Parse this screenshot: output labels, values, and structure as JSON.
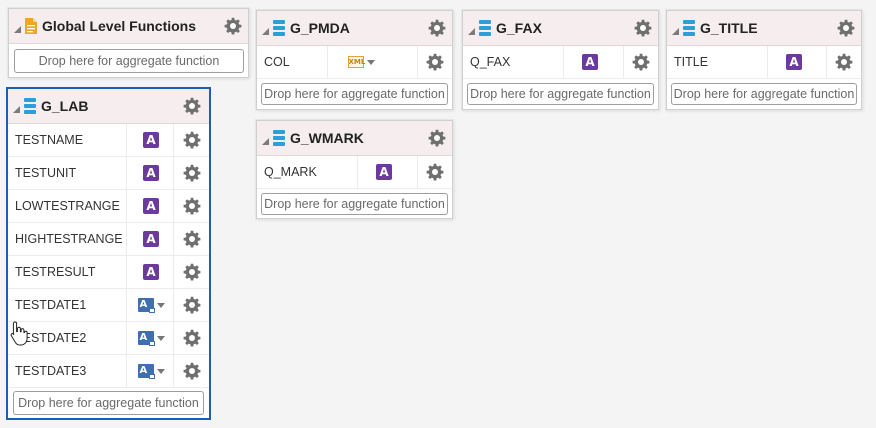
{
  "global": {
    "title": "Global Level Functions",
    "drop": "Drop here for aggregate function"
  },
  "g_lab": {
    "title": "G_LAB",
    "rows": [
      {
        "name": "TESTNAME",
        "type": "text"
      },
      {
        "name": "TESTUNIT",
        "type": "text"
      },
      {
        "name": "LOWTESTRANGE",
        "type": "text"
      },
      {
        "name": "HIGHTESTRANGE",
        "type": "text"
      },
      {
        "name": "TESTRESULT",
        "type": "text"
      },
      {
        "name": "TESTDATE1",
        "type": "date"
      },
      {
        "name": "TESTDATE2",
        "type": "date"
      },
      {
        "name": "TESTDATE3",
        "type": "date"
      }
    ],
    "drop": "Drop here for aggregate function"
  },
  "g_pmda": {
    "title": "G_PMDA",
    "rows": [
      {
        "name": "COL",
        "type": "xml"
      }
    ],
    "drop": "Drop here for aggregate function"
  },
  "g_wmark": {
    "title": "G_WMARK",
    "rows": [
      {
        "name": "Q_MARK",
        "type": "text"
      }
    ],
    "drop": "Drop here for aggregate function"
  },
  "g_fax": {
    "title": "G_FAX",
    "rows": [
      {
        "name": "Q_FAX",
        "type": "text"
      }
    ],
    "drop": "Drop here for aggregate function"
  },
  "g_title": {
    "title": "G_TITLE",
    "rows": [
      {
        "name": "TITLE",
        "type": "text"
      }
    ],
    "drop": "Drop here for aggregate function"
  },
  "icons": {
    "text_type": "A",
    "date_type": "A",
    "xml_type": "XML",
    "gear": "gear-icon",
    "group": "database-icon",
    "global": "document-icon",
    "collapse": "collapse-triangle-icon",
    "cursor": "hand-pointer-icon"
  },
  "colors": {
    "selected_border": "#1a5fb4",
    "header_bg": "#f6eeee",
    "text_type_bg": "#6c3a9c",
    "date_type_bg": "#3f6fb1",
    "group_icon": "#2a9fd8",
    "global_icon": "#f0a52a"
  }
}
